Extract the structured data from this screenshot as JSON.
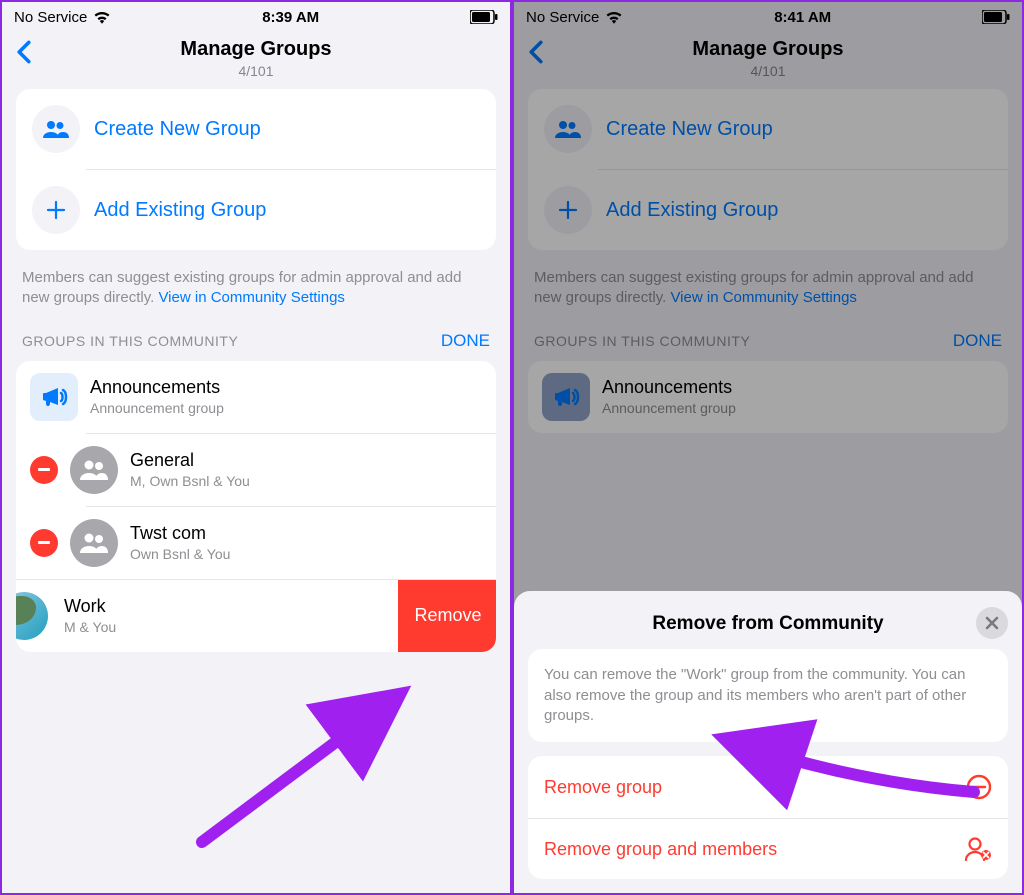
{
  "colors": {
    "accent": "#007aff",
    "destructive": "#ff3b30",
    "gray": "#8e8e93"
  },
  "left": {
    "status": {
      "service": "No Service",
      "time": "8:39 AM"
    },
    "header": {
      "title": "Manage Groups",
      "subtitle": "4/101"
    },
    "actions": {
      "create": "Create New Group",
      "add": "Add Existing Group"
    },
    "hint": {
      "text": "Members can suggest existing groups for admin approval and add new groups directly. ",
      "link": "View in Community Settings"
    },
    "section": {
      "title": "GROUPS IN THIS COMMUNITY",
      "done": "DONE"
    },
    "groups": [
      {
        "title": "Announcements",
        "subtitle": "Announcement group"
      },
      {
        "title": "General",
        "subtitle": "M, Own Bsnl & You"
      },
      {
        "title": "Twst com",
        "subtitle": "Own Bsnl & You"
      },
      {
        "title": "Work",
        "subtitle": "M & You"
      }
    ],
    "remove_button": "Remove"
  },
  "right": {
    "status": {
      "service": "No Service",
      "time": "8:41 AM"
    },
    "header": {
      "title": "Manage Groups",
      "subtitle": "4/101"
    },
    "actions": {
      "create": "Create New Group",
      "add": "Add Existing Group"
    },
    "hint": {
      "text": "Members can suggest existing groups for admin approval and add new groups directly. ",
      "link": "View in Community Settings"
    },
    "section": {
      "title": "GROUPS IN THIS COMMUNITY",
      "done": "DONE"
    },
    "groups": [
      {
        "title": "Announcements",
        "subtitle": "Announcement group"
      }
    ],
    "sheet": {
      "title": "Remove from Community",
      "info": "You can remove the \"Work\" group from the community. You can also remove the group and its members who aren't part of other groups.",
      "action1": "Remove group",
      "action2": "Remove group and members"
    }
  }
}
